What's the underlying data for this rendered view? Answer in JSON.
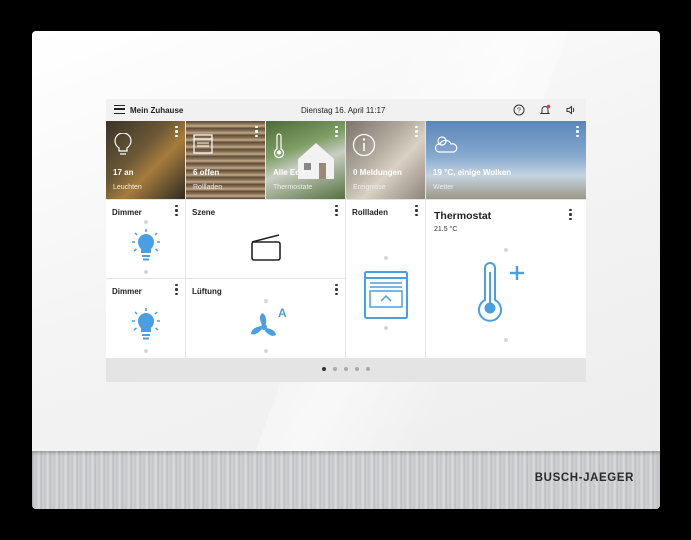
{
  "brand": "BUSCH-JAEGER",
  "header": {
    "home_label": "Mein Zuhause",
    "datetime": "Dienstag 16. April  11:17"
  },
  "overview": [
    {
      "value": "17 an",
      "label": "Leuchten",
      "icon": "bulb-icon"
    },
    {
      "value": "6 offen",
      "label": "Rollladen",
      "icon": "blind-icon"
    },
    {
      "value": "Alle Eco",
      "label": "Thermostate",
      "icon": "thermometer-icon"
    },
    {
      "value": "0 Meldungen",
      "label": "Ereignisse",
      "icon": "info-icon"
    },
    {
      "value": "19 °C, einige Wolken",
      "label": "Wetter",
      "icon": "cloud-sun-icon"
    }
  ],
  "tiles": {
    "dimmer1": {
      "title": "Dimmer",
      "icon": "bulb-icon"
    },
    "scene": {
      "title": "Szene",
      "icon": "scene-icon"
    },
    "blinds": {
      "title": "Rollladen",
      "icon": "blind-icon"
    },
    "thermostat": {
      "title": "Thermostat",
      "temp": "21.5 °C",
      "icon": "thermometer-plus-icon"
    },
    "dimmer2": {
      "title": "Dimmer",
      "icon": "bulb-icon"
    },
    "fan": {
      "title": "Lüftung",
      "mode": "A",
      "icon": "fan-icon"
    }
  },
  "pager": {
    "pages": 5,
    "active": 1
  },
  "colors": {
    "accent": "#4a9fe0",
    "screen_bg": "#e4e4e4"
  }
}
